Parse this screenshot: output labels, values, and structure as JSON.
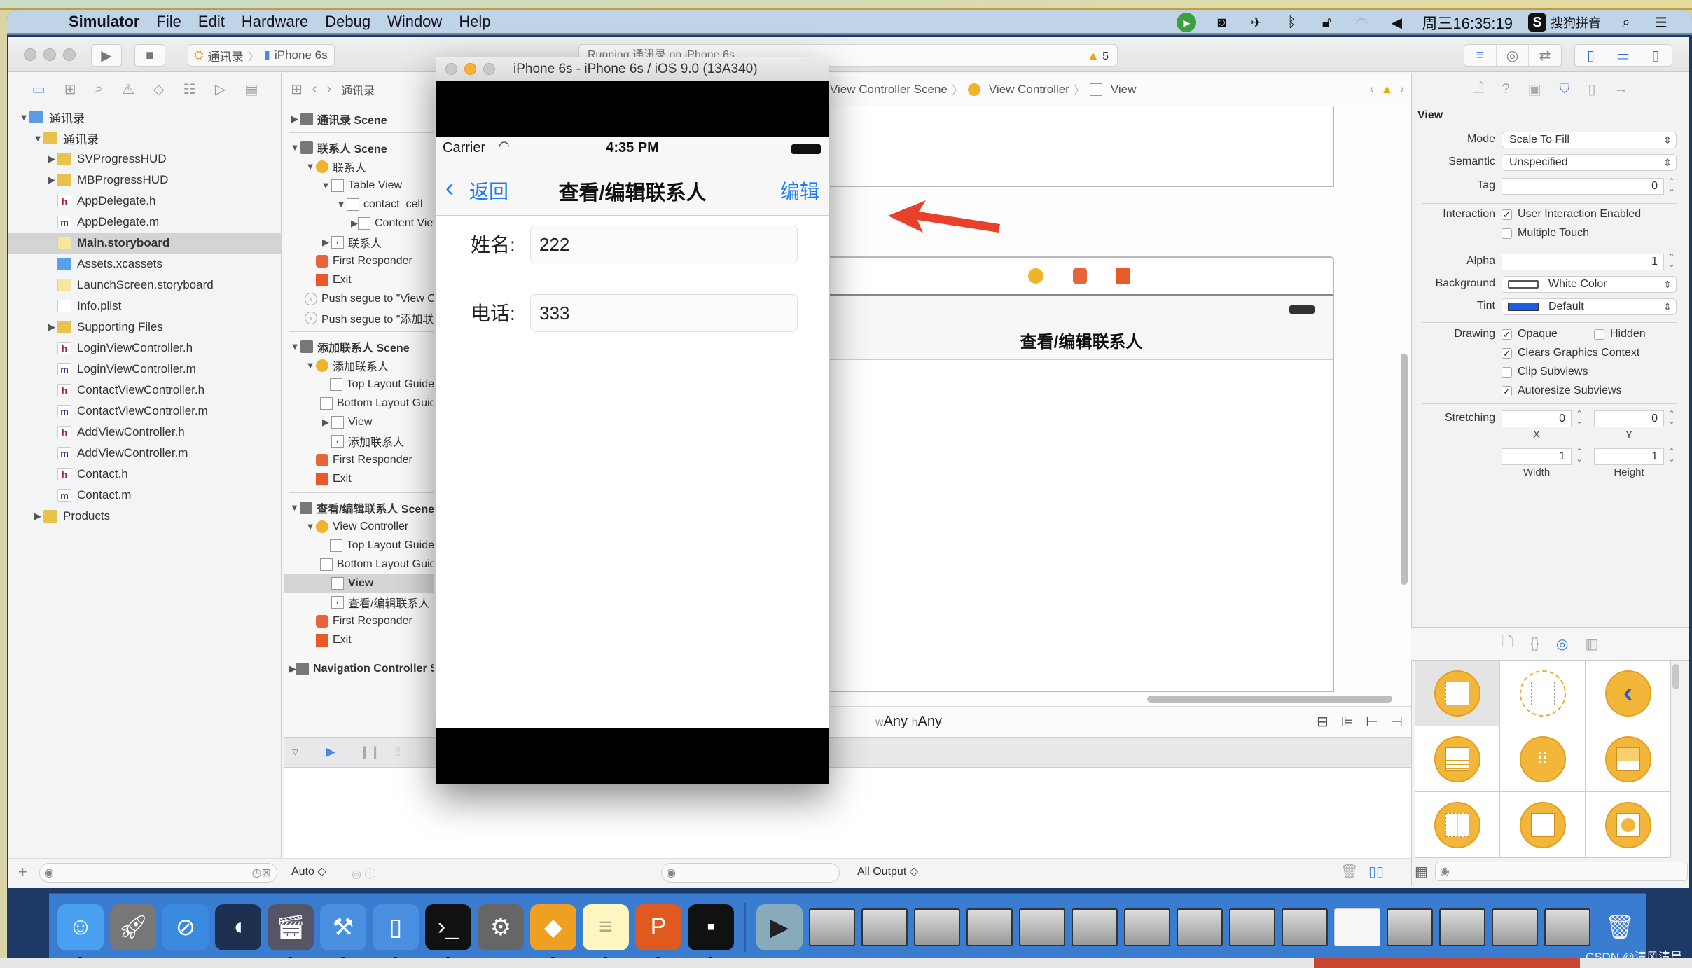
{
  "menubar": {
    "app": "Simulator",
    "items": [
      "File",
      "Edit",
      "Hardware",
      "Debug",
      "Window",
      "Help"
    ],
    "status_icons": [
      "screen-recorder-icon",
      "camera-icon",
      "airplane-icon",
      "bluetooth-icon",
      "lock-icon",
      "wifi-icon",
      "volume-icon"
    ],
    "clock": "周三16:35:19",
    "input_method": "搜狗拼音"
  },
  "toolbar": {
    "scheme_project": "通讯录",
    "scheme_device": "iPhone 6s",
    "activity_text": "Running 通讯录 on iPhone 6s",
    "warning_count": "5"
  },
  "navigator": {
    "items": [
      {
        "label": "通讯录",
        "type": "proj",
        "level": 0,
        "disclosure": "open"
      },
      {
        "label": "通讯录",
        "type": "folder",
        "level": 1,
        "disclosure": "open"
      },
      {
        "label": "SVProgressHUD",
        "type": "folder",
        "level": 2,
        "disclosure": "closed"
      },
      {
        "label": "MBProgressHUD",
        "type": "folder",
        "level": 2,
        "disclosure": "closed"
      },
      {
        "label": "AppDelegate.h",
        "type": "h",
        "level": 2
      },
      {
        "label": "AppDelegate.m",
        "type": "m",
        "level": 2
      },
      {
        "label": "Main.storyboard",
        "type": "sb",
        "level": 2,
        "selected": true
      },
      {
        "label": "Assets.xcassets",
        "type": "assets",
        "level": 2
      },
      {
        "label": "LaunchScreen.storyboard",
        "type": "sb",
        "level": 2
      },
      {
        "label": "Info.plist",
        "type": "plist",
        "level": 2
      },
      {
        "label": "Supporting Files",
        "type": "folder",
        "level": 2,
        "disclosure": "closed"
      },
      {
        "label": "LoginViewController.h",
        "type": "h",
        "level": 2
      },
      {
        "label": "LoginViewController.m",
        "type": "m",
        "level": 2
      },
      {
        "label": "ContactViewController.h",
        "type": "h",
        "level": 2
      },
      {
        "label": "ContactViewController.m",
        "type": "m",
        "level": 2
      },
      {
        "label": "AddViewController.h",
        "type": "h",
        "level": 2
      },
      {
        "label": "AddViewController.m",
        "type": "m",
        "level": 2
      },
      {
        "label": "Contact.h",
        "type": "h",
        "level": 2
      },
      {
        "label": "Contact.m",
        "type": "m",
        "level": 2
      },
      {
        "label": "Products",
        "type": "folder",
        "level": 1,
        "disclosure": "closed"
      }
    ]
  },
  "outline": {
    "breadcrumb": "通讯录",
    "items": [
      {
        "label": "通讯录 Scene",
        "icon": "scene",
        "level": 0,
        "disclosure": "closed",
        "bold": true
      },
      {
        "sep": true
      },
      {
        "label": "联系人 Scene",
        "icon": "scene",
        "level": 0,
        "disclosure": "open",
        "bold": true
      },
      {
        "label": "联系人",
        "icon": "vc",
        "level": 1,
        "disclosure": "open"
      },
      {
        "label": "Table View",
        "icon": "gen",
        "level": 2,
        "disclosure": "open"
      },
      {
        "label": "contact_cell",
        "icon": "gen",
        "level": 3,
        "disclosure": "open"
      },
      {
        "label": "Content View",
        "icon": "gen",
        "level": 4,
        "disclosure": "closed"
      },
      {
        "label": "联系人",
        "icon": "nav",
        "level": 2,
        "disclosure": "closed"
      },
      {
        "label": "First Responder",
        "icon": "fr",
        "level": 1
      },
      {
        "label": "Exit",
        "icon": "exit",
        "level": 1
      },
      {
        "label": "Push segue to \"View Controller\"",
        "icon": "segue",
        "level": 1
      },
      {
        "label": "Push segue to \"添加联系人\"",
        "icon": "segue",
        "level": 1
      },
      {
        "sep": true
      },
      {
        "label": "添加联系人 Scene",
        "icon": "scene",
        "level": 0,
        "disclosure": "open",
        "bold": true
      },
      {
        "label": "添加联系人",
        "icon": "vc",
        "level": 1,
        "disclosure": "open"
      },
      {
        "label": "Top Layout Guide",
        "icon": "gen",
        "level": 2
      },
      {
        "label": "Bottom Layout Guide",
        "icon": "gen",
        "level": 2
      },
      {
        "label": "View",
        "icon": "gen",
        "level": 2,
        "disclosure": "closed"
      },
      {
        "label": "添加联系人",
        "icon": "nav",
        "level": 2
      },
      {
        "label": "First Responder",
        "icon": "fr",
        "level": 1
      },
      {
        "label": "Exit",
        "icon": "exit",
        "level": 1
      },
      {
        "sep": true
      },
      {
        "label": "查看/编辑联系人 Scene",
        "icon": "scene",
        "level": 0,
        "disclosure": "open",
        "bold": true
      },
      {
        "label": "View Controller",
        "icon": "vc",
        "level": 1,
        "disclosure": "open"
      },
      {
        "label": "Top Layout Guide",
        "icon": "gen",
        "level": 2
      },
      {
        "label": "Bottom Layout Guide",
        "icon": "gen",
        "level": 2
      },
      {
        "label": "View",
        "icon": "gen",
        "level": 2,
        "selected": true
      },
      {
        "label": "查看/编辑联系人",
        "icon": "nav",
        "level": 2
      },
      {
        "label": "First Responder",
        "icon": "fr",
        "level": 1
      },
      {
        "label": "Exit",
        "icon": "exit",
        "level": 1
      },
      {
        "sep": true
      },
      {
        "label": "Navigation Controller Scene",
        "icon": "scene",
        "level": 0,
        "disclosure": "closed",
        "bold": true
      }
    ]
  },
  "jumpbar": {
    "crumbs": [
      "View Controller Scene",
      "View Controller",
      "View"
    ]
  },
  "canvas": {
    "scene_title": "查看/编辑联系人",
    "size_class_w": "Any",
    "size_class_h": "Any",
    "annotation_arrow_color": "#e8402a"
  },
  "simulator": {
    "window_title": "iPhone 6s - iPhone 6s / iOS 9.0 (13A340)",
    "status": {
      "carrier": "Carrier",
      "time": "4:35 PM"
    },
    "nav": {
      "back_label": "返回",
      "title": "查看/编辑联系人",
      "right_label": "编辑"
    },
    "fields": [
      {
        "label": "姓名:",
        "value": "222"
      },
      {
        "label": "电话:",
        "value": "333"
      }
    ],
    "tint": "#1a7cf5"
  },
  "debug": {
    "auto_label": "Auto ◇",
    "output_label": "All Output ◇"
  },
  "inspector": {
    "section": "View",
    "mode": {
      "label": "Mode",
      "value": "Scale To Fill"
    },
    "semantic": {
      "label": "Semantic",
      "value": "Unspecified"
    },
    "tag": {
      "label": "Tag",
      "value": "0"
    },
    "interaction": {
      "label": "Interaction",
      "user_interaction_enabled": {
        "label": "User Interaction Enabled",
        "checked": true
      },
      "multiple_touch": {
        "label": "Multiple Touch",
        "checked": false
      }
    },
    "alpha": {
      "label": "Alpha",
      "value": "1"
    },
    "background": {
      "label": "Background",
      "value": "White Color",
      "swatch": "#ffffff"
    },
    "tint": {
      "label": "Tint",
      "value": "Default",
      "swatch": "#1a5fe0"
    },
    "drawing": {
      "label": "Drawing",
      "opaque": {
        "label": "Opaque",
        "checked": true
      },
      "hidden": {
        "label": "Hidden",
        "checked": false
      },
      "clears_graphics_context": {
        "label": "Clears Graphics Context",
        "checked": true
      },
      "clip_subviews": {
        "label": "Clip Subviews",
        "checked": false
      },
      "autoresize_subviews": {
        "label": "Autoresize Subviews",
        "checked": true
      }
    },
    "stretching": {
      "label": "Stretching",
      "x": "0",
      "y": "0",
      "width": "1",
      "height": "1",
      "x_label": "X",
      "y_label": "Y",
      "width_label": "Width",
      "height_label": "Height"
    }
  },
  "library": {
    "items": [
      "view-controller",
      "storyboard-reference",
      "navigation-controller",
      "table-view-controller",
      "collection-view-controller",
      "tab-bar-controller",
      "split-view-controller",
      "page-view-controller",
      "glkit-view-controller"
    ]
  },
  "dock": {
    "apps": [
      "finder",
      "launchpad",
      "safari",
      "mouse-app",
      "video-app",
      "xcode",
      "simulator",
      "terminal",
      "system-preferences",
      "sketch",
      "notes",
      "powerpoint",
      "console"
    ]
  },
  "watermark": "CSDN @清风清晨"
}
